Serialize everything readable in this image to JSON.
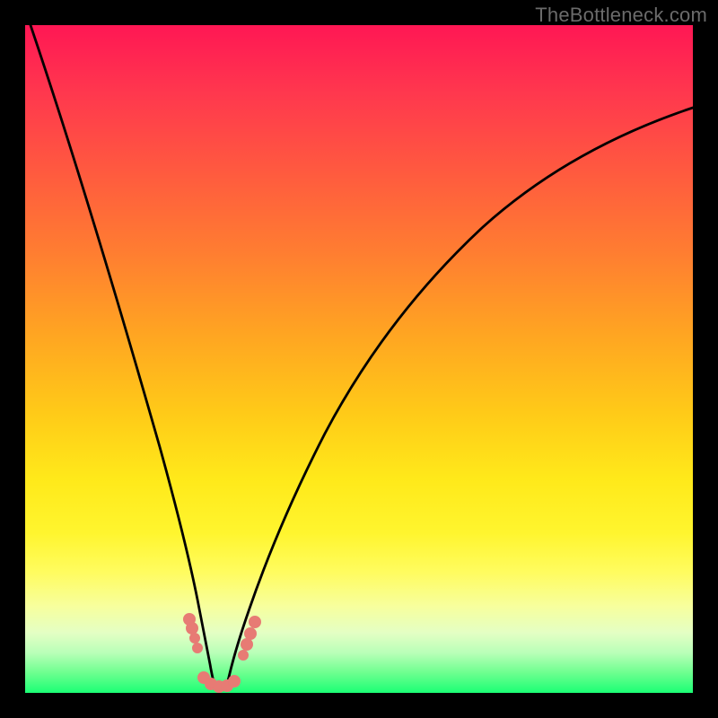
{
  "watermark": "TheBottleneck.com",
  "chart_data": {
    "type": "line",
    "title": "",
    "xlabel": "",
    "ylabel": "",
    "xlim": [
      0,
      100
    ],
    "ylim": [
      0,
      100
    ],
    "x": [
      0,
      5,
      10,
      15,
      18,
      20,
      22,
      24,
      25,
      26,
      27,
      28,
      29,
      30,
      32,
      34,
      36,
      38,
      40,
      45,
      50,
      55,
      60,
      65,
      70,
      75,
      80,
      85,
      90,
      95,
      100
    ],
    "y": [
      100,
      83,
      66,
      48,
      36,
      28,
      19,
      10,
      5,
      2,
      0.5,
      0,
      0.5,
      2,
      7,
      14,
      22,
      29,
      36,
      49,
      58,
      65,
      70,
      74,
      77,
      80,
      82,
      84,
      85.5,
      87,
      88
    ],
    "series": [
      {
        "name": "curve",
        "color": "#000000"
      }
    ],
    "markers": {
      "color": "#e77b74",
      "clusters": [
        {
          "approx_x_range": [
            24,
            25
          ],
          "approx_y_range": [
            5,
            11
          ]
        },
        {
          "approx_x_range": [
            26,
            30
          ],
          "approx_y_range": [
            0,
            3
          ]
        },
        {
          "approx_x_range": [
            31,
            33
          ],
          "approx_y_range": [
            4,
            11
          ]
        }
      ]
    }
  }
}
